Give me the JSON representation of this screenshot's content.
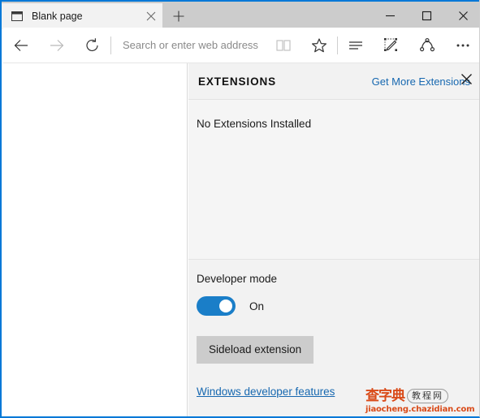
{
  "window": {
    "accent_color": "#0078d7",
    "controls": {
      "minimize": "minimize",
      "maximize": "maximize",
      "close": "close"
    }
  },
  "tabs": [
    {
      "title": "Blank page",
      "icon": "page-icon",
      "close_label": "Close tab"
    }
  ],
  "newtab": {
    "label": "New tab"
  },
  "toolbar": {
    "back": "Back",
    "forward": "Forward",
    "refresh": "Refresh",
    "reading_view": "Reading view",
    "favorites": "Add to favorites or reading list",
    "hub": "Hub",
    "web_note": "Make a Web Note",
    "share": "Share",
    "more": "More"
  },
  "address": {
    "value": "",
    "placeholder": "Search or enter web address"
  },
  "panel": {
    "title": "EXTENSIONS",
    "get_more_link": "Get More Extensions",
    "close_label": "Close",
    "empty_message": "No Extensions Installed",
    "developer": {
      "label": "Developer mode",
      "toggle_state": "On",
      "toggle_on": true,
      "toggle_color": "#1a7ec8",
      "sideload_button": "Sideload extension",
      "features_link": "Windows developer features"
    }
  },
  "watermark": {
    "cn_title": "查字典",
    "cn_badge": "教程网",
    "url": "jiaocheng.chazidian.com"
  }
}
